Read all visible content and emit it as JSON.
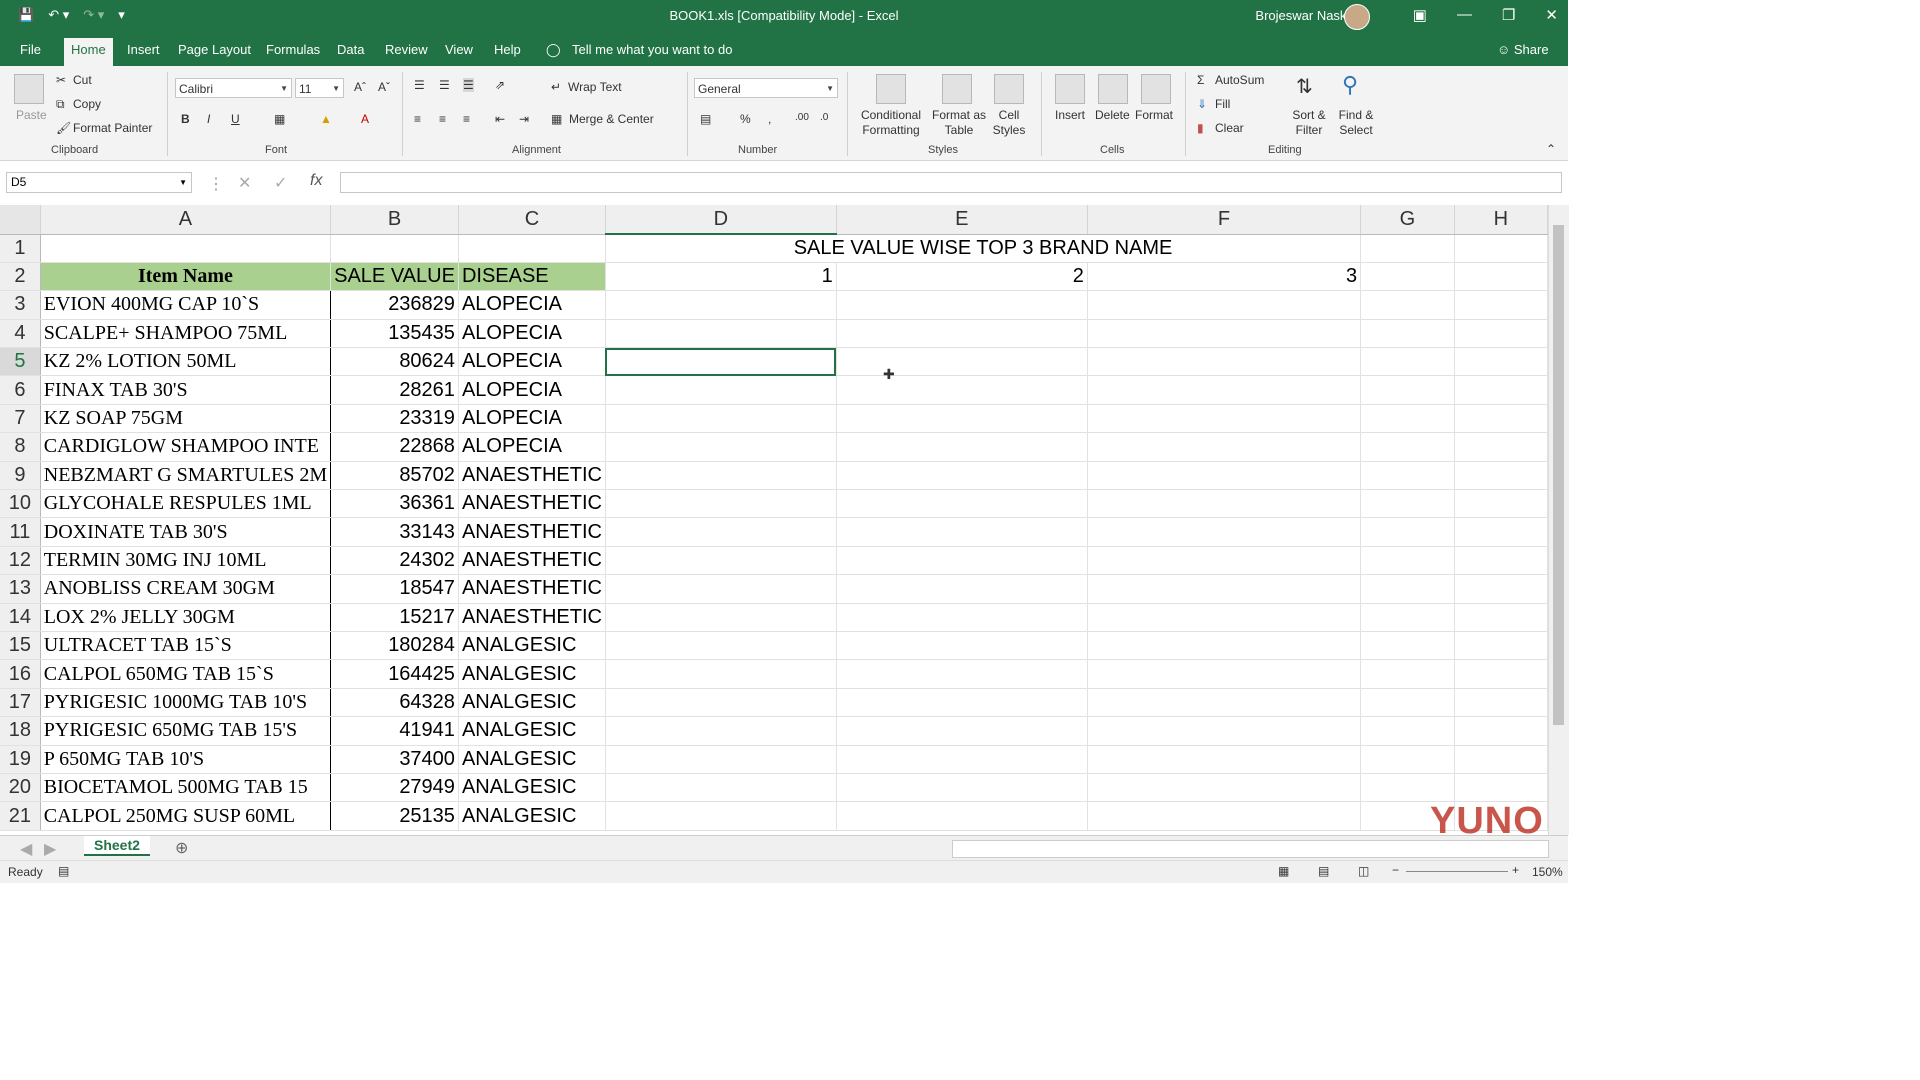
{
  "titlebar": {
    "title": "BOOK1.xls  [Compatibility Mode]  -  Excel",
    "user": "Brojeswar Naskar"
  },
  "menu": [
    "File",
    "Home",
    "Insert",
    "Page Layout",
    "Formulas",
    "Data",
    "Review",
    "View",
    "Help"
  ],
  "tellme": "Tell me what you want to do",
  "share": "Share",
  "ribbon": {
    "clipboard": {
      "paste": "Paste",
      "cut": "Cut",
      "copy": "Copy",
      "format_painter": "Format Painter",
      "label": "Clipboard"
    },
    "font": {
      "name": "Calibri",
      "size": "11",
      "label": "Font"
    },
    "alignment": {
      "wrap": "Wrap Text",
      "merge": "Merge & Center",
      "label": "Alignment"
    },
    "number": {
      "format": "General",
      "label": "Number"
    },
    "styles": {
      "conditional": "Conditional Formatting",
      "format_table": "Format as Table",
      "cell_styles": "Cell Styles",
      "label": "Styles"
    },
    "cells": {
      "insert": "Insert",
      "delete": "Delete",
      "format": "Format",
      "label": "Cells"
    },
    "editing": {
      "autosum": "AutoSum",
      "fill": "Fill",
      "clear": "Clear",
      "sort": "Sort & Filter",
      "find": "Find & Select",
      "label": "Editing"
    }
  },
  "namebox": "D5",
  "columns": [
    "A",
    "B",
    "C",
    "D",
    "E",
    "F",
    "G",
    "H"
  ],
  "selected_col": "D",
  "selected_row": "5",
  "sheet_title": "SALE VALUE WISE TOP 3 BRAND NAME",
  "headers": {
    "item": "Item Name",
    "sale": "SALE VALUE",
    "disease": "DISEASE"
  },
  "ranks": [
    "1",
    "2",
    "3"
  ],
  "rows": [
    {
      "n": "3",
      "item": "EVION 400MG CAP 10`S",
      "sale": "236829",
      "disease": "ALOPECIA"
    },
    {
      "n": "4",
      "item": "SCALPE+ SHAMPOO 75ML",
      "sale": "135435",
      "disease": "ALOPECIA"
    },
    {
      "n": "5",
      "item": "KZ 2% LOTION 50ML",
      "sale": "80624",
      "disease": "ALOPECIA"
    },
    {
      "n": "6",
      "item": "FINAX TAB 30'S",
      "sale": "28261",
      "disease": "ALOPECIA"
    },
    {
      "n": "7",
      "item": "KZ SOAP 75GM",
      "sale": "23319",
      "disease": "ALOPECIA"
    },
    {
      "n": "8",
      "item": "CARDIGLOW SHAMPOO INTE",
      "sale": "22868",
      "disease": "ALOPECIA"
    },
    {
      "n": "9",
      "item": "NEBZMART G SMARTULES 2M",
      "sale": "85702",
      "disease": "ANAESTHETIC"
    },
    {
      "n": "10",
      "item": "GLYCOHALE RESPULES 1ML",
      "sale": "36361",
      "disease": "ANAESTHETIC"
    },
    {
      "n": "11",
      "item": "DOXINATE TAB 30'S",
      "sale": "33143",
      "disease": "ANAESTHETIC"
    },
    {
      "n": "12",
      "item": "TERMIN 30MG INJ 10ML",
      "sale": "24302",
      "disease": "ANAESTHETIC"
    },
    {
      "n": "13",
      "item": "ANOBLISS CREAM 30GM",
      "sale": "18547",
      "disease": "ANAESTHETIC"
    },
    {
      "n": "14",
      "item": "LOX 2% JELLY 30GM",
      "sale": "15217",
      "disease": "ANAESTHETIC"
    },
    {
      "n": "15",
      "item": "ULTRACET TAB 15`S",
      "sale": "180284",
      "disease": "ANALGESIC"
    },
    {
      "n": "16",
      "item": "CALPOL 650MG TAB 15`S",
      "sale": "164425",
      "disease": "ANALGESIC"
    },
    {
      "n": "17",
      "item": "PYRIGESIC 1000MG TAB 10'S",
      "sale": "64328",
      "disease": "ANALGESIC"
    },
    {
      "n": "18",
      "item": "PYRIGESIC 650MG TAB 15'S",
      "sale": "41941",
      "disease": "ANALGESIC"
    },
    {
      "n": "19",
      "item": "P 650MG TAB 10'S",
      "sale": "37400",
      "disease": "ANALGESIC"
    },
    {
      "n": "20",
      "item": "BIOCETAMOL 500MG TAB 15",
      "sale": "27949",
      "disease": "ANALGESIC"
    },
    {
      "n": "21",
      "item": "CALPOL 250MG SUSP 60ML",
      "sale": "25135",
      "disease": "ANALGESIC"
    }
  ],
  "sheet_tab": "Sheet2",
  "status": {
    "ready": "Ready",
    "zoom": "150%"
  },
  "watermark": "YUNO"
}
